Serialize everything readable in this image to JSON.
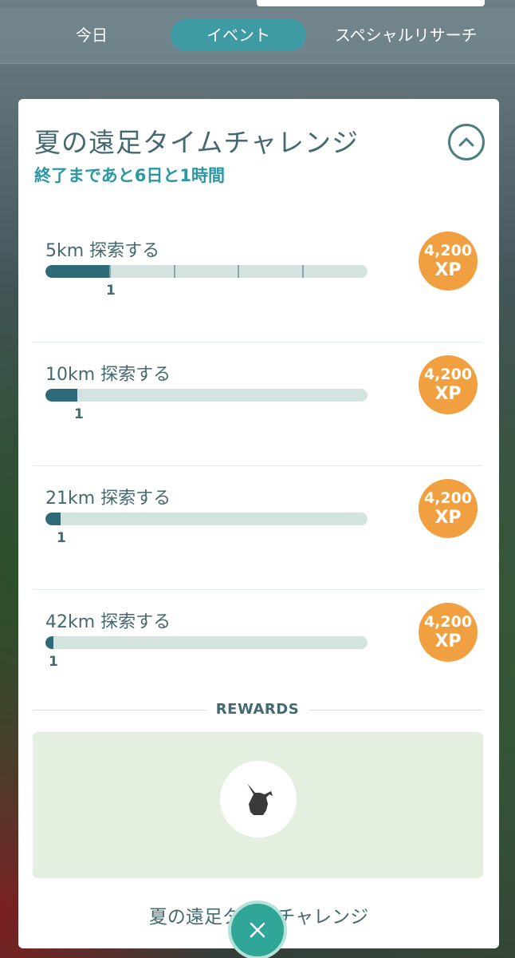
{
  "tabs": [
    {
      "label": "今日",
      "active": false
    },
    {
      "label": "イベント",
      "active": true
    },
    {
      "label": "スペシャルリサーチ",
      "active": false
    }
  ],
  "card": {
    "title": "夏の遠足タイムチャレンジ",
    "countdown": "終了まであと6日と1時間",
    "collapse_icon": "chevron-up-icon"
  },
  "tasks": [
    {
      "label": "5km 探索する",
      "progress_value": "1",
      "progress_fraction": 0.2,
      "reward_amount": "4,200",
      "reward_unit": "XP"
    },
    {
      "label": "10km 探索する",
      "progress_value": "1",
      "progress_fraction": 0.1,
      "reward_amount": "4,200",
      "reward_unit": "XP"
    },
    {
      "label": "21km 探索する",
      "progress_value": "1",
      "progress_fraction": 0.048,
      "reward_amount": "4,200",
      "reward_unit": "XP"
    },
    {
      "label": "42km 探索する",
      "progress_value": "1",
      "progress_fraction": 0.024,
      "reward_amount": "4,200",
      "reward_unit": "XP"
    }
  ],
  "rewards": {
    "label": "REWARDS",
    "item_icon": "pikachu-silhouette-icon"
  },
  "footer": {
    "title": "夏の遠足タイムチャレンジ",
    "close_icon": "close-icon"
  },
  "colors": {
    "accent_teal": "#3e9aa3",
    "xp_orange": "#f0a040",
    "progress_fill": "#2e6a78",
    "progress_track": "#d3e3df",
    "text_primary": "#44696f",
    "countdown_teal": "#2a98a4",
    "rewards_bg": "#e5efdf",
    "close_button": "#2fa697"
  }
}
